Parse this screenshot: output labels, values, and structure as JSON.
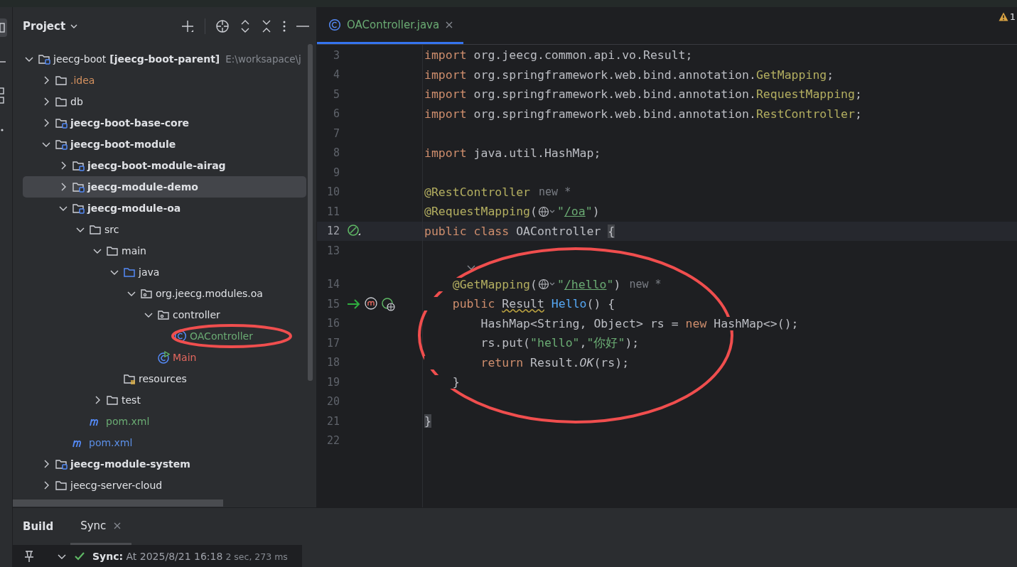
{
  "project_panel": {
    "title": "Project",
    "tree": [
      {
        "label": "jeecg-boot",
        "module": "[jeecg-boot-parent]",
        "path": "E:\\worksapace\\j",
        "kind": "module",
        "bold": false,
        "expanded": true,
        "selected": false,
        "children": [
          {
            "label": ".idea",
            "kind": "folder",
            "bold": false,
            "color": "#d6925f",
            "expanded": false,
            "selected": false
          },
          {
            "label": "db",
            "kind": "folder",
            "bold": false,
            "expanded": false,
            "selected": false
          },
          {
            "label": "jeecg-boot-base-core",
            "kind": "module",
            "bold": true,
            "expanded": false,
            "selected": false
          },
          {
            "label": "jeecg-boot-module",
            "kind": "module",
            "bold": true,
            "expanded": true,
            "selected": false,
            "children": [
              {
                "label": "jeecg-boot-module-airag",
                "kind": "module",
                "bold": true,
                "expanded": false,
                "selected": false
              },
              {
                "label": "jeecg-module-demo",
                "kind": "module",
                "bold": true,
                "expanded": false,
                "selected": true
              },
              {
                "label": "jeecg-module-oa",
                "kind": "module",
                "bold": true,
                "expanded": true,
                "selected": false,
                "children": [
                  {
                    "label": "src",
                    "kind": "folder",
                    "bold": false,
                    "expanded": true,
                    "selected": false,
                    "children": [
                      {
                        "label": "main",
                        "kind": "folder",
                        "bold": false,
                        "expanded": true,
                        "selected": false,
                        "children": [
                          {
                            "label": "java",
                            "kind": "source",
                            "bold": false,
                            "expanded": true,
                            "selected": false,
                            "children": [
                              {
                                "label": "org.jeecg.modules.oa",
                                "kind": "package",
                                "bold": false,
                                "expanded": true,
                                "selected": false,
                                "children": [
                                  {
                                    "label": "controller",
                                    "kind": "package",
                                    "bold": false,
                                    "expanded": true,
                                    "selected": false,
                                    "children": [
                                      {
                                        "label": "OAController",
                                        "kind": "class",
                                        "bold": false,
                                        "color": "#6aab73",
                                        "selected": false
                                      }
                                    ]
                                  },
                                  {
                                    "label": "Main",
                                    "kind": "main",
                                    "bold": false,
                                    "color": "#e5685f",
                                    "selected": false
                                  }
                                ]
                              }
                            ]
                          },
                          {
                            "label": "resources",
                            "kind": "resources",
                            "bold": false,
                            "selected": false
                          }
                        ]
                      },
                      {
                        "label": "test",
                        "kind": "folder",
                        "bold": false,
                        "expanded": false,
                        "selected": false
                      }
                    ]
                  },
                  {
                    "label": "pom.xml",
                    "kind": "maven",
                    "bold": false,
                    "color": "#6aab73",
                    "selected": false
                  }
                ]
              },
              {
                "label": "pom.xml",
                "kind": "maven",
                "bold": false,
                "color": "#5c8fe6",
                "selected": false
              }
            ]
          },
          {
            "label": "jeecg-module-system",
            "kind": "module",
            "bold": true,
            "expanded": false,
            "selected": false
          },
          {
            "label": "jeecg-server-cloud",
            "kind": "folder",
            "bold": false,
            "expanded": false,
            "selected": false
          }
        ]
      }
    ]
  },
  "editor": {
    "tabs": [
      {
        "label": "OAController.java",
        "kind": "class",
        "color": "#6aab73",
        "selected": true
      }
    ],
    "warnings": "1",
    "lines": [
      {
        "number": "3",
        "tokens": [
          {
            "text": "import",
            "kind": "kw"
          },
          {
            "text": " org.jeecg.common.api.vo.Result;",
            "kind": "plain"
          }
        ]
      },
      {
        "number": "4",
        "tokens": [
          {
            "text": "import",
            "kind": "kw"
          },
          {
            "text": " org.springframework.web.bind.annotation.",
            "kind": "plain"
          },
          {
            "text": "GetMapping",
            "kind": "ann"
          },
          {
            "text": ";",
            "kind": "plain"
          }
        ]
      },
      {
        "number": "5",
        "tokens": [
          {
            "text": "import",
            "kind": "kw"
          },
          {
            "text": " org.springframework.web.bind.annotation.",
            "kind": "plain"
          },
          {
            "text": "RequestMapping",
            "kind": "ann"
          },
          {
            "text": ";",
            "kind": "plain"
          }
        ]
      },
      {
        "number": "6",
        "tokens": [
          {
            "text": "import",
            "kind": "kw"
          },
          {
            "text": " org.springframework.web.bind.annotation.",
            "kind": "plain"
          },
          {
            "text": "RestController",
            "kind": "ann"
          },
          {
            "text": ";",
            "kind": "plain"
          }
        ]
      },
      {
        "number": "7"
      },
      {
        "number": "8",
        "tokens": [
          {
            "text": "import",
            "kind": "kw"
          },
          {
            "text": " java.util.HashMap;",
            "kind": "plain"
          }
        ]
      },
      {
        "number": "9"
      },
      {
        "number": "10",
        "tokens": [
          {
            "text": "@RestController",
            "kind": "ann"
          },
          {
            "text": "new *",
            "kind": "hint"
          }
        ]
      },
      {
        "number": "11",
        "tokens": [
          {
            "text": "@RequestMapping",
            "kind": "ann"
          },
          {
            "text": "(",
            "kind": "plain"
          },
          {
            "kind": "globe"
          },
          {
            "text": "\"",
            "kind": "str"
          },
          {
            "text": "/oa",
            "kind": "link"
          },
          {
            "text": "\"",
            "kind": "str"
          },
          {
            "text": ")",
            "kind": "plain"
          }
        ]
      },
      {
        "number": "12",
        "current": true,
        "markers": [
          {
            "kind": "bean"
          }
        ],
        "tokens": [
          {
            "text": "public class",
            "kind": "kw"
          },
          {
            "text": " OAController ",
            "kind": "plain"
          },
          {
            "text": "{",
            "kind": "brace"
          }
        ]
      },
      {
        "number": "13"
      },
      {
        "number": "14",
        "inlay": true,
        "tokens": [
          {
            "text": "    @GetMapping",
            "kind": "ann"
          },
          {
            "text": "(",
            "kind": "plain"
          },
          {
            "kind": "globe"
          },
          {
            "text": "\"",
            "kind": "str"
          },
          {
            "text": "/hello",
            "kind": "link"
          },
          {
            "text": "\"",
            "kind": "str"
          },
          {
            "text": ")",
            "kind": "plain"
          },
          {
            "text": "new *",
            "kind": "hint"
          }
        ]
      },
      {
        "number": "15",
        "markers": [
          {
            "kind": "run"
          },
          {
            "kind": "method"
          },
          {
            "kind": "endpoint"
          }
        ],
        "tokens": [
          {
            "text": "    public ",
            "kind": "kw"
          },
          {
            "text": "Result",
            "kind": "warn"
          },
          {
            "text": " Hello",
            "kind": "method"
          },
          {
            "text": "() {",
            "kind": "plain"
          }
        ]
      },
      {
        "number": "16",
        "tokens": [
          {
            "text": "        HashMap<String, Object> rs = ",
            "kind": "plain"
          },
          {
            "text": "new",
            "kind": "kw"
          },
          {
            "text": " HashMap<>();",
            "kind": "plain"
          }
        ]
      },
      {
        "number": "17",
        "tokens": [
          {
            "text": "        rs.put(",
            "kind": "plain"
          },
          {
            "text": "\"hello\"",
            "kind": "str"
          },
          {
            "text": ",",
            "kind": "plain"
          },
          {
            "text": "\"你好\"",
            "kind": "str"
          },
          {
            "text": ");",
            "kind": "plain"
          }
        ]
      },
      {
        "number": "18",
        "tokens": [
          {
            "text": "        return",
            "kind": "kw"
          },
          {
            "text": " Result.",
            "kind": "plain"
          },
          {
            "text": "OK",
            "kind": "static"
          },
          {
            "text": "(rs);",
            "kind": "plain"
          }
        ]
      },
      {
        "number": "19",
        "tokens": [
          {
            "text": "    }",
            "kind": "plain"
          }
        ]
      },
      {
        "number": "20"
      },
      {
        "number": "21",
        "tokens": [
          {
            "text": "}",
            "kind": "brace"
          }
        ]
      },
      {
        "number": "22"
      }
    ]
  },
  "bottom_panel": {
    "title": "Build",
    "tabs": [
      {
        "label": "Sync",
        "selected": true
      }
    ],
    "sync": {
      "expanded": true,
      "success": true,
      "label": "Sync:",
      "text": "At 2025/8/21 16:18",
      "duration": "2 sec, 273 ms"
    }
  }
}
